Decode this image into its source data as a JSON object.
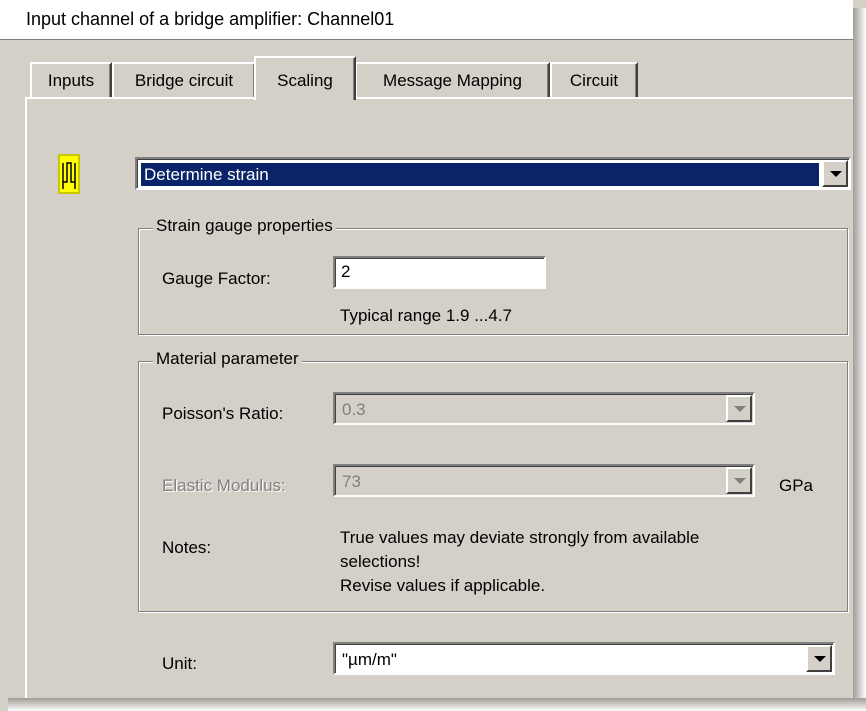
{
  "window": {
    "title": "Input channel of a bridge amplifier: Channel01"
  },
  "tabs": [
    {
      "label": "Inputs",
      "active": false
    },
    {
      "label": "Bridge circuit",
      "active": false
    },
    {
      "label": "Scaling",
      "active": true
    },
    {
      "label": "Message Mapping",
      "active": false
    },
    {
      "label": "Circuit",
      "active": false
    }
  ],
  "scaling": {
    "icon": "strain-gauge-icon",
    "mode_select": {
      "value": "Determine strain"
    },
    "strain_gauge": {
      "legend": "Strain gauge properties",
      "gauge_factor_label": "Gauge Factor:",
      "gauge_factor_value": "2",
      "hint": "Typical range 1.9 ...4.7"
    },
    "material": {
      "legend": "Material parameter",
      "poisson_label": "Poisson's Ratio:",
      "poisson_value": "0.3",
      "elastic_label": "Elastic Modulus:",
      "elastic_value": "73",
      "elastic_unit": "GPa",
      "notes_label": "Notes:",
      "notes_lines": [
        "True values may deviate strongly from available",
        "selections!",
        "Revise values if applicable."
      ]
    },
    "unit": {
      "label": "Unit:",
      "value": "\"µm/m\""
    }
  },
  "colors": {
    "face": "#d4d0c8",
    "selection": "#0a246a",
    "icon_background": "#ffff00"
  }
}
